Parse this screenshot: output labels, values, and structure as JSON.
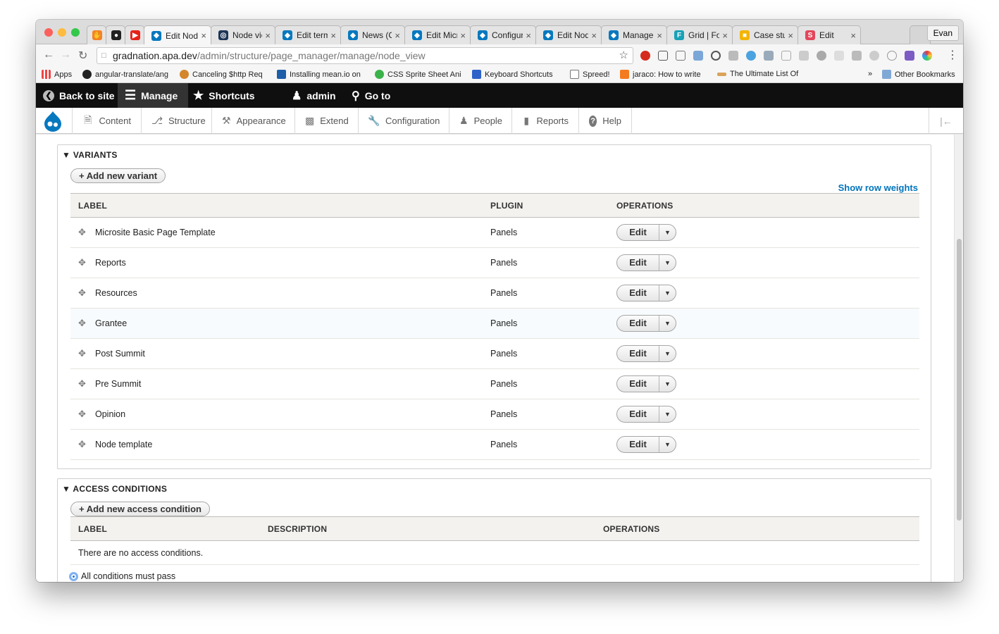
{
  "browser": {
    "tabs": [
      {
        "title": "",
        "fav": "#f48225",
        "glyph": "✋"
      },
      {
        "title": "",
        "fav": "#222",
        "glyph": "●"
      },
      {
        "title": "",
        "fav": "#e62117",
        "glyph": "▶"
      },
      {
        "title": "Edit Nod",
        "fav": "#0678be",
        "glyph": "◆",
        "active": true
      },
      {
        "title": "Node vie",
        "fav": "#1d3557",
        "glyph": "◎"
      },
      {
        "title": "Edit term",
        "fav": "#0678be",
        "glyph": "◆"
      },
      {
        "title": "News (C",
        "fav": "#0678be",
        "glyph": "◆"
      },
      {
        "title": "Edit Micr",
        "fav": "#0678be",
        "glyph": "◆"
      },
      {
        "title": "Configur",
        "fav": "#0678be",
        "glyph": "◆"
      },
      {
        "title": "Edit Nod",
        "fav": "#0678be",
        "glyph": "◆"
      },
      {
        "title": "Manage",
        "fav": "#0678be",
        "glyph": "◆"
      },
      {
        "title": "Grid | Fo",
        "fav": "#17a2b8",
        "glyph": "F"
      },
      {
        "title": "Case stu",
        "fav": "#f4b400",
        "glyph": "■"
      },
      {
        "title": "Edit",
        "fav": "#e2475b",
        "glyph": "S"
      }
    ],
    "profile": "Evan",
    "url_host": "gradnation.apa.dev",
    "url_path": "/admin/structure/page_manager/manage/node_view",
    "bookmarks": [
      "Apps",
      "angular-translate/ang",
      "Canceling $http Req",
      "Installing mean.io on",
      "CSS Sprite Sheet Ani",
      "Keyboard Shortcuts",
      "Spreed!",
      "jaraco: How to write",
      "The Ultimate List Of",
      "»",
      "Other Bookmarks"
    ]
  },
  "drupal": {
    "toolbar": {
      "back": "Back to site",
      "manage": "Manage",
      "shortcuts": "Shortcuts",
      "user": "admin",
      "goto": "Go to"
    },
    "menu": [
      "Content",
      "Structure",
      "Appearance",
      "Extend",
      "Configuration",
      "People",
      "Reports",
      "Help"
    ]
  },
  "variants": {
    "legend": "VARIANTS",
    "add_button": "+ Add new variant",
    "show_weights": "Show row weights",
    "headers": {
      "label": "LABEL",
      "plugin": "PLUGIN",
      "operations": "OPERATIONS"
    },
    "rows": [
      {
        "label": "Microsite Basic Page Template",
        "plugin": "Panels",
        "op": "Edit"
      },
      {
        "label": "Reports",
        "plugin": "Panels",
        "op": "Edit"
      },
      {
        "label": "Resources",
        "plugin": "Panels",
        "op": "Edit"
      },
      {
        "label": "Grantee",
        "plugin": "Panels",
        "op": "Edit"
      },
      {
        "label": "Post Summit",
        "plugin": "Panels",
        "op": "Edit"
      },
      {
        "label": "Pre Summit",
        "plugin": "Panels",
        "op": "Edit"
      },
      {
        "label": "Opinion",
        "plugin": "Panels",
        "op": "Edit"
      },
      {
        "label": "Node template",
        "plugin": "Panels",
        "op": "Edit"
      }
    ]
  },
  "access": {
    "legend": "ACCESS CONDITIONS",
    "add_button": "+ Add new access condition",
    "headers": {
      "label": "LABEL",
      "description": "DESCRIPTION",
      "operations": "OPERATIONS"
    },
    "empty": "There are no access conditions.",
    "radio_label": "All conditions must pass"
  }
}
